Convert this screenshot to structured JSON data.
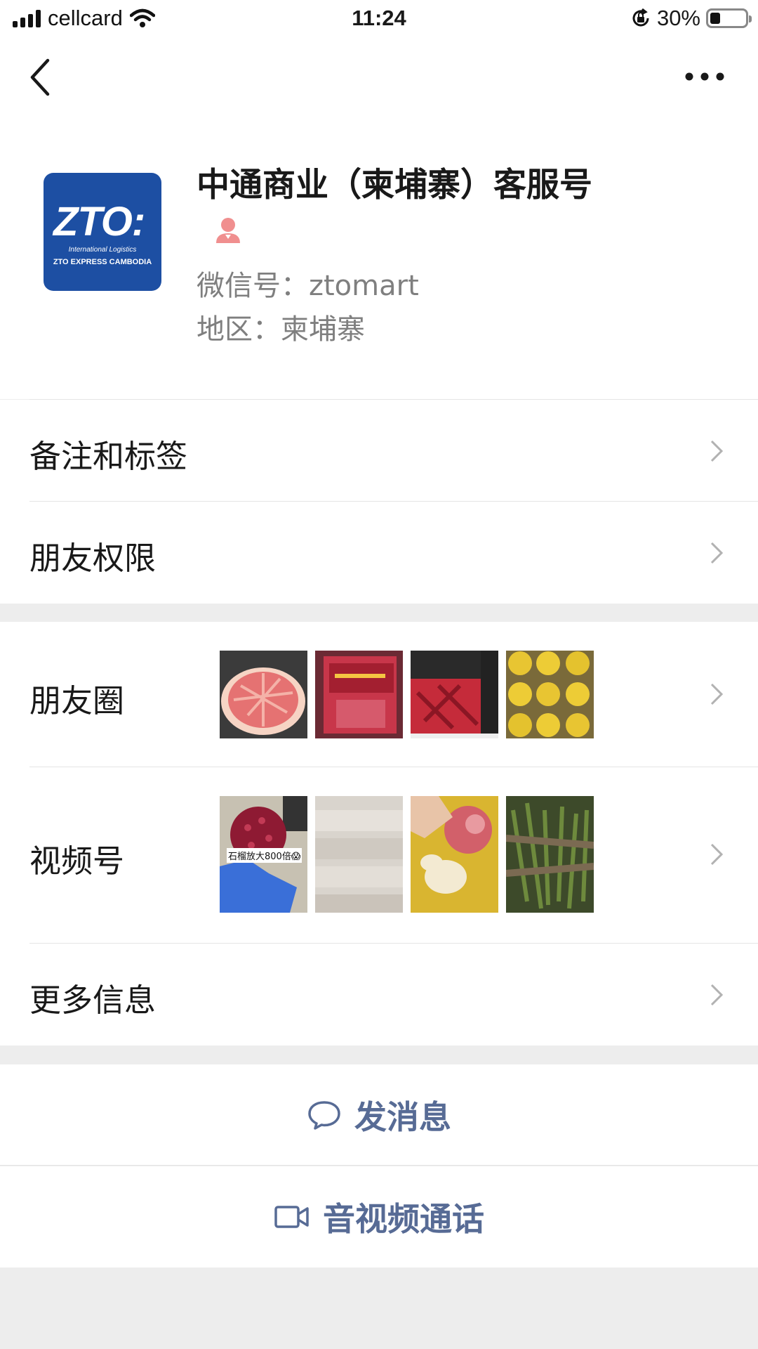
{
  "status_bar": {
    "carrier": "cellcard",
    "time": "11:24",
    "battery_text": "30%",
    "battery_level": 0.3
  },
  "profile": {
    "name": "中通商业（柬埔寨）客服号",
    "wechat_id_label": "微信号：",
    "wechat_id": "ztomart",
    "region_label": "地区：",
    "region": "柬埔寨",
    "avatar": {
      "logo_text": "ZTO:",
      "logo_sub1": "International Logistics",
      "logo_sub2": "ZTO EXPRESS CAMBODIA",
      "bg_color": "#1d4fa3"
    },
    "gender_icon": "female-avatar-icon"
  },
  "menu": {
    "remarks_label": "备注和标签",
    "permissions_label": "朋友权限",
    "moments_label": "朋友圈",
    "channels_label": "视频号",
    "more_info_label": "更多信息"
  },
  "channels": {
    "first_thumb_caption": "石榴放大800倍😱"
  },
  "actions": {
    "message_label": "发消息",
    "call_label": "音视频通话"
  },
  "colors": {
    "link_blue": "#576b95",
    "background": "#ededed"
  }
}
